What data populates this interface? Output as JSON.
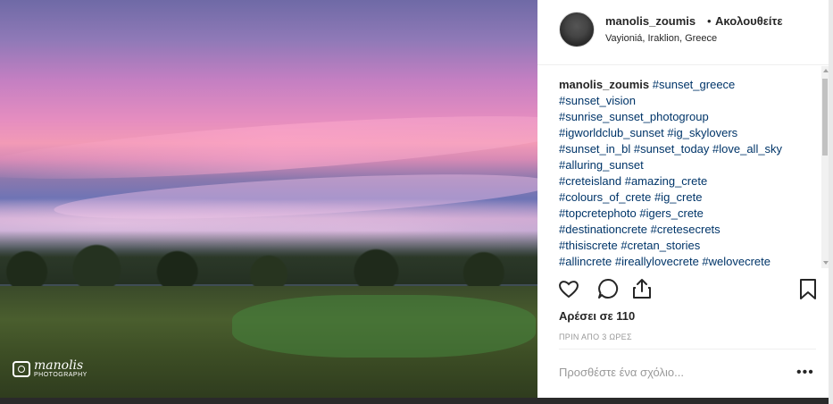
{
  "post": {
    "username": "manolis_zoumis",
    "separator": "•",
    "follow_label": "Ακολουθείτε",
    "location": "Vayioniá, Iraklion, Greece",
    "caption_user": "manolis_zoumis",
    "caption_lines": [
      "#sunset_greece",
      "#sunset_vision",
      "#sunrise_sunset_photogroup",
      "#igworldclub_sunset #ig_skylovers",
      "#sunset_in_bl #sunset_today #love_all_sky",
      "#alluring_sunset",
      "#creteisland #amazing_crete",
      "#colours_of_crete #ig_crete",
      "#topcretephoto #igers_crete",
      "#destinationcrete #cretesecrets",
      "#thisiscrete #cretan_stories",
      "#allincrete #ireallylovecrete #welovecrete"
    ],
    "likes": "Αρέσει σε 110",
    "time": "ΠΡΙΝ ΑΠΟ 3 ΩΡΕΣ",
    "comment_placeholder": "Προσθέστε ένα σχόλιο...",
    "more": "•••"
  },
  "photo": {
    "watermark_script": "manolis",
    "watermark_sub": "PHOTOGRAPHY"
  },
  "icons": [
    "heart-icon",
    "comment-icon",
    "share-icon",
    "bookmark-icon",
    "camera-icon"
  ]
}
